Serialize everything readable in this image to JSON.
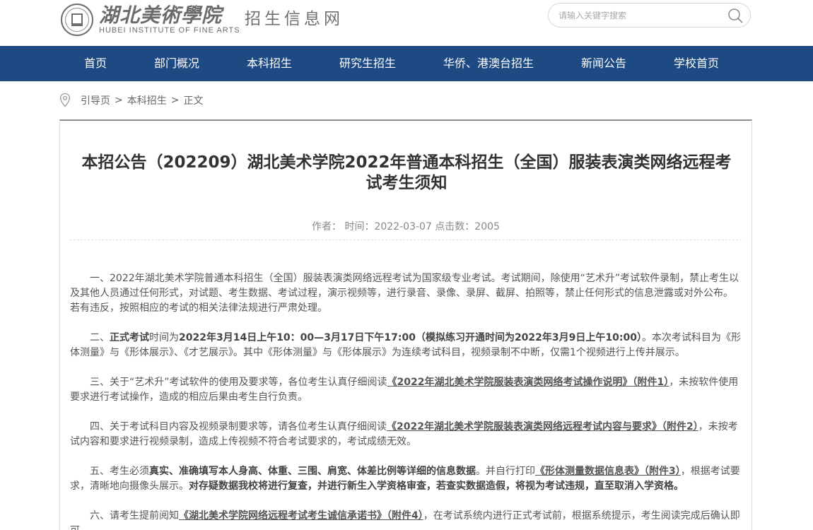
{
  "header": {
    "logo_cn": "湖北美術學院",
    "logo_en": "HUBEI INSTITUTE OF FINE ARTS",
    "site_name": "招生信息网",
    "search_placeholder": "请输入关键字搜索",
    "search_icon": "search-icon"
  },
  "colors": {
    "nav_bg": "#1d4a82",
    "nav_text": "#ffffff",
    "panel_top_border": "#8c8c8c"
  },
  "nav": {
    "items": [
      {
        "label": "首页"
      },
      {
        "label": "部门概况"
      },
      {
        "label": "本科招生"
      },
      {
        "label": "研究生招生"
      },
      {
        "label": "华侨、港澳台招生"
      },
      {
        "label": "新闻公告"
      },
      {
        "label": "学校首页"
      }
    ]
  },
  "breadcrumb": {
    "icon": "location-pin-icon",
    "items": [
      "引导页",
      "本科招生",
      "正文"
    ],
    "separator": ">"
  },
  "article": {
    "title": "本招公告（202209）湖北美术学院2022年普通本科招生（全国）服装表演类网络远程考试考生须知",
    "meta": "作者：  时间：2022-03-07 点击数：2005",
    "paragraphs": {
      "p1": "一、2022年湖北美术学院普通本科招生（全国）服装表演类网络远程考试为国家级专业考试。考试期间，除使用“艺术升”考试软件录制，禁止考生以及其他人员通过任何形式，对试题、考生数据、考试过程，演示视频等，进行录音、录像、录屏、截屏、拍照等，禁止任何形式的信息泄露或对外公布。若有违反，按照相应的考试的相关法律法规进行严肃处理。",
      "p2_a": "二、",
      "p2_b": "正式考试",
      "p2_c": "时间为",
      "p2_d": "2022年3月14日上午10：00—3月17日下午17:00（模拟练习开通时间为2022年3月9日上午10:00）",
      "p2_e": "。本次考试科目为《形体测量》与《形体展示》、《才艺展示》。其中《形体测量》与《形体展示》为连续考试科目，视频录制不中断，仅需1个视频进行上传并展示。",
      "p3_a": "三、关于“艺术升”考试软件的使用及要求等，各位考生认真仔细阅读",
      "p3_link": "《2022年湖北美术学院服装表演类网络考试操作说明》（附件1）",
      "p3_b": "，未按软件使用要求进行考试操作，造成的相应后果由考生自行负责。",
      "p4_a": "四、关于考试科目内容及视频录制要求等，请各位考生认真仔细阅读",
      "p4_link": "《2022年湖北美术学院服装表演类网络远程考试内容与要求》（附件2）",
      "p4_b": "，未按考试内容和要求进行视频录制，造成上传视频不符合考试要求的，考试成绩无效。",
      "p5_a": "五、考生必须",
      "p5_b": "真实、准确填写本人身高、体重、三围、肩宽、体差比例等详细的信息数据",
      "p5_c": "。并自行打印",
      "p5_link": "《形体测量数据信息表》（附件3）",
      "p5_d": "，根据考试要求，清晰地向摄像头展示。",
      "p5_e": "对存疑数据我校将进行复查，并进行新生入学资格审查，若查实数据造假，将视为考试违规，直至取消入学资格。",
      "p6_a": "六、请考生提前阅知",
      "p6_link": "《湖北美术学院网络远程考试考生诚信承诺书》（附件4）",
      "p6_b": "，在考试系统内进行正式考试前，根据系统提示，考生阅读完成后确认即可。"
    }
  }
}
